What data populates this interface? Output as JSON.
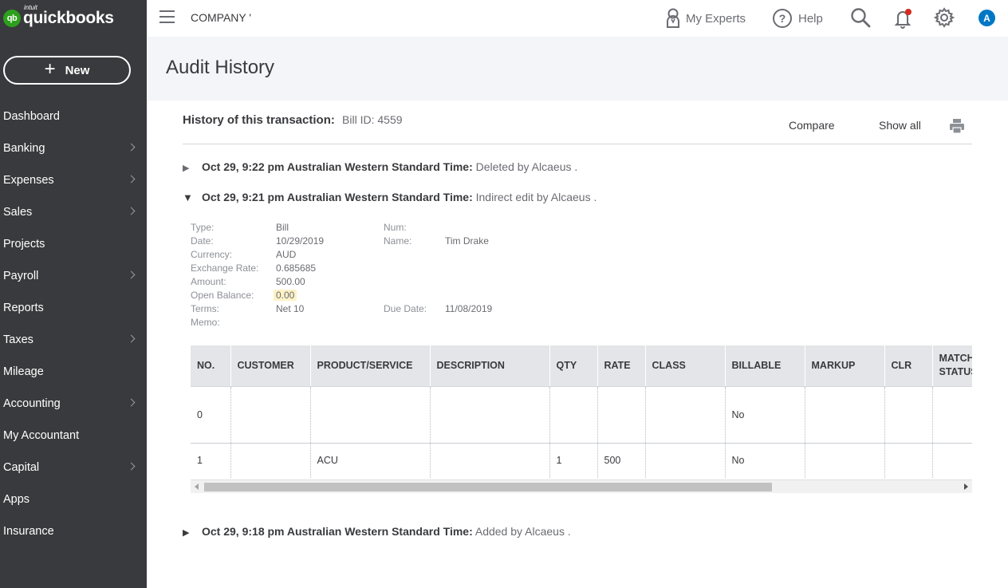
{
  "brand": {
    "intuit": "intuit",
    "name": "quickbooks",
    "badge": "qb"
  },
  "sidebar": {
    "new_label": "New",
    "items": [
      {
        "label": "Dashboard",
        "has_arrow": false
      },
      {
        "label": "Banking",
        "has_arrow": true
      },
      {
        "label": "Expenses",
        "has_arrow": true
      },
      {
        "label": "Sales",
        "has_arrow": true
      },
      {
        "label": "Projects",
        "has_arrow": false
      },
      {
        "label": "Payroll",
        "has_arrow": true
      },
      {
        "label": "Reports",
        "has_arrow": false
      },
      {
        "label": "Taxes",
        "has_arrow": true
      },
      {
        "label": "Mileage",
        "has_arrow": false
      },
      {
        "label": "Accounting",
        "has_arrow": true
      },
      {
        "label": "My Accountant",
        "has_arrow": false
      },
      {
        "label": "Capital",
        "has_arrow": true
      },
      {
        "label": "Apps",
        "has_arrow": false
      },
      {
        "label": "Insurance",
        "has_arrow": false
      }
    ]
  },
  "topbar": {
    "company": "COMPANY '",
    "my_experts": "My Experts",
    "help": "Help",
    "help_glyph": "?",
    "avatar_initial": "A"
  },
  "page": {
    "title": "Audit History"
  },
  "history": {
    "label": "History of this transaction:",
    "transaction": "Bill ID: 4559",
    "compare": "Compare",
    "show_all": "Show all"
  },
  "events": [
    {
      "time": "Oct 29, 9:22 pm Australian Western Standard Time:",
      "action": "Deleted by Alcaeus .",
      "expanded": false
    },
    {
      "time": "Oct 29, 9:21 pm Australian Western Standard Time:",
      "action": "Indirect edit by Alcaeus .",
      "expanded": true
    },
    {
      "time": "Oct 29, 9:18 pm Australian Western Standard Time:",
      "action": "Added by Alcaeus .",
      "expanded": false
    }
  ],
  "details": {
    "type_label": "Type:",
    "type": "Bill",
    "date_label": "Date:",
    "date": "10/29/2019",
    "currency_label": "Currency:",
    "currency": "AUD",
    "exchange_label": "Exchange Rate:",
    "exchange": "0.685685",
    "amount_label": "Amount:",
    "amount": "500.00",
    "open_balance_label": "Open Balance:",
    "open_balance": "0.00",
    "terms_label": "Terms:",
    "terms": "Net 10",
    "memo_label": "Memo:",
    "num_label": "Num:",
    "name_label": "Name:",
    "name": "Tim Drake",
    "due_label": "Due Date:",
    "due": "11/08/2019"
  },
  "table": {
    "columns": [
      "NO.",
      "CUSTOMER",
      "PRODUCT/SERVICE",
      "DESCRIPTION",
      "QTY",
      "RATE",
      "CLASS",
      "BILLABLE",
      "MARKUP",
      "CLR",
      "MATCH STATUS"
    ],
    "rows": [
      [
        "0",
        "",
        "",
        "",
        "",
        "",
        "",
        "No",
        "",
        "",
        ""
      ],
      [
        "1",
        "",
        "ACU",
        "",
        "1",
        "500",
        "",
        "No",
        "",
        "",
        ""
      ]
    ]
  },
  "icons": {
    "hamburger": "menu-icon",
    "experts": "person-badge-icon",
    "search": "search-icon",
    "bell": "bell-icon",
    "gear": "gear-icon",
    "print": "printer-icon"
  },
  "colors": {
    "sidebar": "#393a3d",
    "brand": "#2ca01c",
    "avatar": "#0077c5",
    "notification": "#d52b1e",
    "highlight": "#fdf2c6"
  }
}
